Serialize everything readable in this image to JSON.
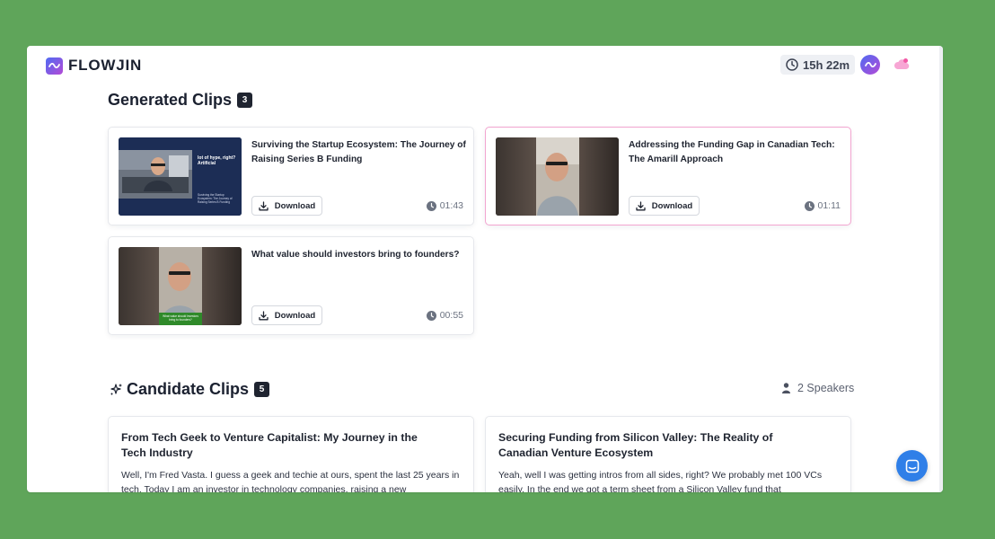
{
  "app": {
    "name": "FLOWJIN"
  },
  "header": {
    "time_remaining": "15h 22m"
  },
  "generated": {
    "title": "Generated Clips",
    "count": "3",
    "clips": [
      {
        "title": "Surviving the Startup Ecosystem: The Journey of Raising Series B Funding",
        "download_label": "Download",
        "duration": "01:43",
        "thumb_caption": "lot of hype, right? Artificial",
        "thumb_subcaption": "Surviving the Startup Ecosystem: The Journey of Raising Series B Funding"
      },
      {
        "title": "Addressing the Funding Gap in Canadian Tech: The Amarill Approach",
        "download_label": "Download",
        "duration": "01:11"
      },
      {
        "title": "What value should investors bring to founders?",
        "download_label": "Download",
        "duration": "00:55",
        "thumb_caption": "What value should investors bring to founders?"
      }
    ]
  },
  "candidates": {
    "title": "Candidate Clips",
    "count": "5",
    "speakers": "2 Speakers",
    "clips": [
      {
        "title": "From Tech Geek to Venture Capitalist: My Journey in the Tech Industry",
        "excerpt": "Well, I'm Fred Vasta. I guess a geek and techie at ours, spent the last 25 years in tech. Today I am an investor in technology companies, raising a new"
      },
      {
        "title": "Securing Funding from Silicon Valley: The Reality of Canadian Venture Ecosystem",
        "excerpt": "Yeah, well I was getting intros from all sides, right? We probably met 100 VCs easily. In the end we got a term sheet from a Silicon Valley fund that"
      }
    ]
  },
  "colors": {
    "page_bg": "#5fa55a",
    "brand_gradient_start": "#4f6bf2",
    "brand_gradient_end": "#b44ad6",
    "selected_border": "#f2a5d0",
    "chat_button": "#2f7fe8"
  },
  "icons": {
    "logo": "wave-icon",
    "time": "clock-icon",
    "cloud": "cloud-icon",
    "download": "download-icon",
    "duration": "clock-icon",
    "sparkle": "sparkle-icon",
    "speaker": "person-icon",
    "chat": "chat-icon"
  }
}
